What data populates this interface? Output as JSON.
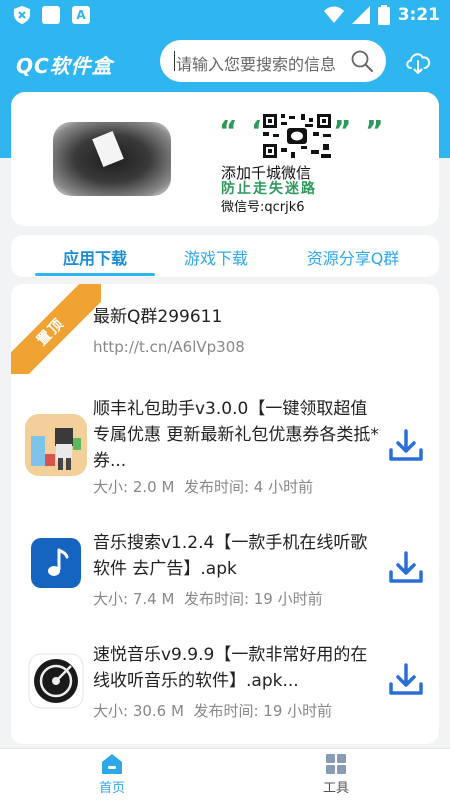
{
  "status_bar": {
    "time": "3:21",
    "notif_letter": "A"
  },
  "header": {
    "logo": "QC软件盒",
    "search_placeholder": "请输入您要搜索的信息"
  },
  "banner": {
    "quote_open": "“ “",
    "quote_close": "” ”",
    "line1": "添加千城微信",
    "line2": "防止走失迷路",
    "line3": "微信号:qcrjk6"
  },
  "tabs": [
    {
      "label": "应用下载",
      "active": true
    },
    {
      "label": "游戏下载",
      "active": false
    },
    {
      "label": "资源分享Q群",
      "active": false
    }
  ],
  "pinned": {
    "badge": "置顶",
    "title": "最新Q群299611",
    "link": "http://t.cn/A6lVp308"
  },
  "items": [
    {
      "title": "顺丰礼包助手v3.0.0【一键领取超值专属优惠 更新最新礼包优惠券各类抵*券...",
      "size": "大小:  2.0 M",
      "time": "发布时间:  4 小时前",
      "icon": "gift-app-icon"
    },
    {
      "title": "音乐搜索v1.2.4【一款手机在线听歌软件 去广告】.apk",
      "size": "大小:  7.4 M",
      "time": "发布时间:  19 小时前",
      "icon": "music-note-app-icon"
    },
    {
      "title": "速悦音乐v9.9.9【一款非常好用的在线收听音乐的软件】.apk...",
      "size": "大小:  30.6 M",
      "time": "发布时间:  19 小时前",
      "icon": "vinyl-app-icon"
    }
  ],
  "bottom_nav": [
    {
      "label": "首页",
      "icon": "home-icon",
      "active": true
    },
    {
      "label": "工具",
      "icon": "tools-grid-icon",
      "active": false
    }
  ],
  "colors": {
    "brand": "#2fb6f0",
    "tab_active": "#1a8fd6",
    "ribbon": "#f0a232",
    "download": "#2a6fd6"
  }
}
